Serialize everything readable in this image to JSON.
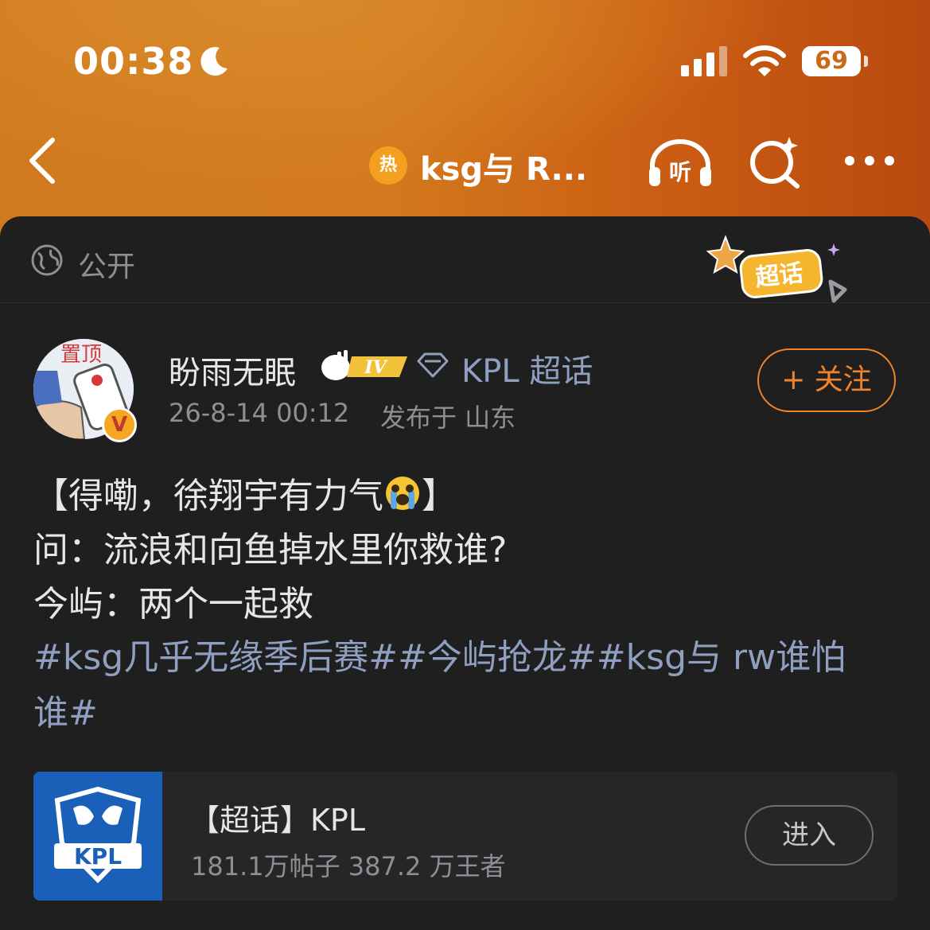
{
  "status_bar": {
    "time": "00:38",
    "battery": "69"
  },
  "nav": {
    "hot_badge": "热",
    "title": "ksg与 R...",
    "listen_label": "听"
  },
  "visibility": {
    "label": "公开"
  },
  "sticker": {
    "label": "超话"
  },
  "author": {
    "name": "盼雨无眠",
    "level": "IV",
    "topic": "KPL 超话",
    "date": "26-8-14 00:12",
    "location": "发布于 山东",
    "verified": "V",
    "avatar_text": "置顶"
  },
  "follow_button": "+ 关注",
  "post": {
    "line1_before": "【得嘞，徐翔宇有力气",
    "line1_after": "】",
    "line2": "问：流浪和向鱼掉水里你救谁?",
    "line3": "今屿：两个一起救",
    "hashtags": "#ksg几乎无缘季后赛##今屿抢龙##ksg与 rw谁怕谁#"
  },
  "card": {
    "logo_text": "KPL",
    "title": "【超话】KPL",
    "subtitle": "181.1万帖子 387.2 万王者",
    "enter_button": "进入"
  },
  "colors": {
    "accent": "#f0842a",
    "link": "#8f9fbf",
    "card_logo_bg": "#1a5fb8"
  }
}
